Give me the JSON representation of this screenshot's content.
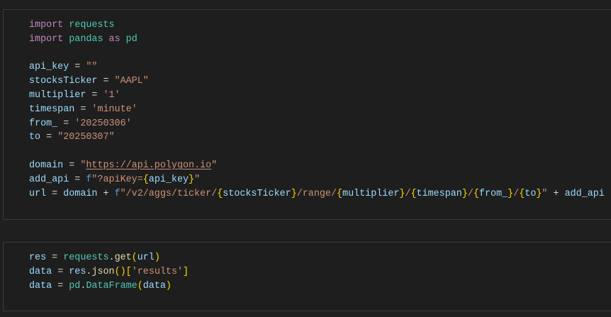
{
  "cells": [
    {
      "lines": [
        [
          {
            "t": "import",
            "c": "kw"
          },
          {
            "t": " ",
            "c": "op"
          },
          {
            "t": "requests",
            "c": "mod"
          }
        ],
        [
          {
            "t": "import",
            "c": "kw"
          },
          {
            "t": " ",
            "c": "op"
          },
          {
            "t": "pandas",
            "c": "mod"
          },
          {
            "t": " ",
            "c": "op"
          },
          {
            "t": "as",
            "c": "kw"
          },
          {
            "t": " ",
            "c": "op"
          },
          {
            "t": "pd",
            "c": "mod"
          }
        ],
        [],
        [
          {
            "t": "api_key",
            "c": "var"
          },
          {
            "t": " = ",
            "c": "op"
          },
          {
            "t": "\"\"",
            "c": "str"
          }
        ],
        [
          {
            "t": "stocksTicker",
            "c": "var"
          },
          {
            "t": " = ",
            "c": "op"
          },
          {
            "t": "\"AAPL\"",
            "c": "str"
          }
        ],
        [
          {
            "t": "multiplier",
            "c": "var"
          },
          {
            "t": " = ",
            "c": "op"
          },
          {
            "t": "'1'",
            "c": "str"
          }
        ],
        [
          {
            "t": "timespan",
            "c": "var"
          },
          {
            "t": " = ",
            "c": "op"
          },
          {
            "t": "'minute'",
            "c": "str"
          }
        ],
        [
          {
            "t": "from_",
            "c": "var"
          },
          {
            "t": " = ",
            "c": "op"
          },
          {
            "t": "'20250306'",
            "c": "str"
          }
        ],
        [
          {
            "t": "to",
            "c": "var"
          },
          {
            "t": " = ",
            "c": "op"
          },
          {
            "t": "\"20250307\"",
            "c": "str"
          }
        ],
        [],
        [
          {
            "t": "domain",
            "c": "var"
          },
          {
            "t": " = ",
            "c": "op"
          },
          {
            "t": "\"",
            "c": "str"
          },
          {
            "t": "https://api.polygon.io",
            "c": "link"
          },
          {
            "t": "\"",
            "c": "str"
          }
        ],
        [
          {
            "t": "add_api",
            "c": "var"
          },
          {
            "t": " = ",
            "c": "op"
          },
          {
            "t": "f",
            "c": "fpre"
          },
          {
            "t": "\"?apiKey=",
            "c": "str"
          },
          {
            "t": "{",
            "c": "br1"
          },
          {
            "t": "api_key",
            "c": "var"
          },
          {
            "t": "}",
            "c": "br1"
          },
          {
            "t": "\"",
            "c": "str"
          }
        ],
        [
          {
            "t": "url",
            "c": "var"
          },
          {
            "t": " = ",
            "c": "op"
          },
          {
            "t": "domain",
            "c": "var"
          },
          {
            "t": " + ",
            "c": "op"
          },
          {
            "t": "f",
            "c": "fpre"
          },
          {
            "t": "\"/v2/aggs/ticker/",
            "c": "str"
          },
          {
            "t": "{",
            "c": "br1"
          },
          {
            "t": "stocksTicker",
            "c": "var"
          },
          {
            "t": "}",
            "c": "br1"
          },
          {
            "t": "/range/",
            "c": "str"
          },
          {
            "t": "{",
            "c": "br1"
          },
          {
            "t": "multiplier",
            "c": "var"
          },
          {
            "t": "}",
            "c": "br1"
          },
          {
            "t": "/",
            "c": "str"
          },
          {
            "t": "{",
            "c": "br1"
          },
          {
            "t": "timespan",
            "c": "var"
          },
          {
            "t": "}",
            "c": "br1"
          },
          {
            "t": "/",
            "c": "str"
          },
          {
            "t": "{",
            "c": "br1"
          },
          {
            "t": "from_",
            "c": "var"
          },
          {
            "t": "}",
            "c": "br1"
          },
          {
            "t": "/",
            "c": "str"
          },
          {
            "t": "{",
            "c": "br1"
          },
          {
            "t": "to",
            "c": "var"
          },
          {
            "t": "}",
            "c": "br1"
          },
          {
            "t": "\"",
            "c": "str"
          },
          {
            "t": " + ",
            "c": "op"
          },
          {
            "t": "add_api",
            "c": "var"
          }
        ]
      ]
    },
    {
      "lines": [
        [
          {
            "t": "res",
            "c": "var"
          },
          {
            "t": " = ",
            "c": "op"
          },
          {
            "t": "requests",
            "c": "mod"
          },
          {
            "t": ".",
            "c": "op"
          },
          {
            "t": "get",
            "c": "fn"
          },
          {
            "t": "(",
            "c": "br1"
          },
          {
            "t": "url",
            "c": "var"
          },
          {
            "t": ")",
            "c": "br1"
          }
        ],
        [
          {
            "t": "data",
            "c": "var"
          },
          {
            "t": " = ",
            "c": "op"
          },
          {
            "t": "res",
            "c": "var"
          },
          {
            "t": ".",
            "c": "op"
          },
          {
            "t": "json",
            "c": "fn"
          },
          {
            "t": "(",
            "c": "br1"
          },
          {
            "t": ")",
            "c": "br1"
          },
          {
            "t": "[",
            "c": "br1"
          },
          {
            "t": "'results'",
            "c": "str"
          },
          {
            "t": "]",
            "c": "br1"
          }
        ],
        [
          {
            "t": "data",
            "c": "var"
          },
          {
            "t": " = ",
            "c": "op"
          },
          {
            "t": "pd",
            "c": "mod"
          },
          {
            "t": ".",
            "c": "op"
          },
          {
            "t": "DataFrame",
            "c": "mod"
          },
          {
            "t": "(",
            "c": "br1"
          },
          {
            "t": "data",
            "c": "var"
          },
          {
            "t": ")",
            "c": "br1"
          }
        ]
      ]
    }
  ]
}
